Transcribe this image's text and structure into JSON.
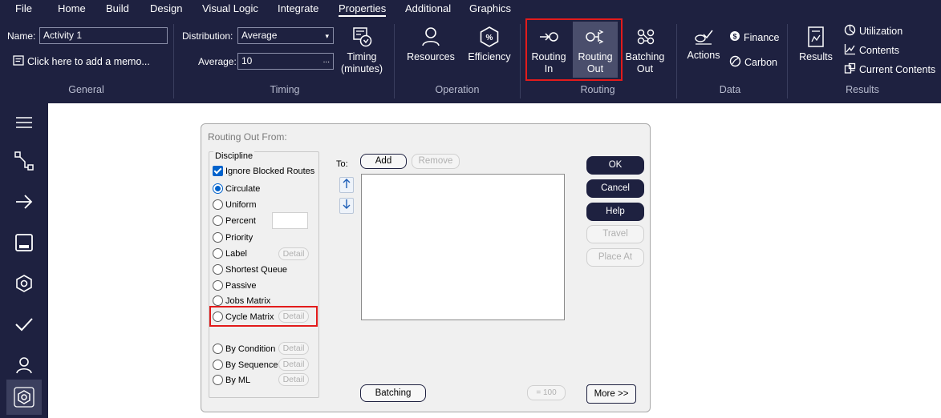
{
  "menu": {
    "tabs": [
      "File",
      "Home",
      "Build",
      "Design",
      "Visual Logic",
      "Integrate",
      "Properties",
      "Additional",
      "Graphics"
    ],
    "active": "Properties"
  },
  "general": {
    "name_label": "Name:",
    "name_value": "Activity 1",
    "memo": "Click here to add a memo...",
    "group": "General"
  },
  "timing": {
    "distribution_label": "Distribution:",
    "distribution_value": "Average",
    "average_label": "Average:",
    "average_value": "10",
    "ellipsis": "...",
    "timing_button": [
      "Timing",
      "(minutes)"
    ],
    "group": "Timing"
  },
  "operation": {
    "resources": "Resources",
    "efficiency": "Efficiency",
    "group": "Operation"
  },
  "routing": {
    "routing_in": [
      "Routing",
      "In"
    ],
    "routing_out": [
      "Routing",
      "Out"
    ],
    "batching_out": [
      "Batching",
      "Out"
    ],
    "group": "Routing"
  },
  "data_group": {
    "actions": "Actions",
    "finance": "Finance",
    "carbon": "Carbon",
    "group": "Data"
  },
  "results_group": {
    "results": "Results",
    "utilization": "Utilization",
    "contents": "Contents",
    "current_contents": "Current Contents",
    "group": "Results"
  },
  "sidebar": {
    "icons": [
      "menu-icon",
      "connector-icon",
      "arrow-right-icon",
      "save-icon",
      "settings-hexagon-icon",
      "check-icon",
      "user-icon",
      "active-settings-icon"
    ]
  },
  "dialog": {
    "title": "Routing Out From:",
    "discipline_legend": "Discipline",
    "ignore_blocked": "Ignore Blocked Routes",
    "options": {
      "circulate": "Circulate",
      "uniform": "Uniform",
      "percent": "Percent",
      "priority": "Priority",
      "label": "Label",
      "shortest_queue": "Shortest Queue",
      "passive": "Passive",
      "jobs_matrix": "Jobs Matrix",
      "cycle_matrix": "Cycle Matrix",
      "by_condition": "By Condition",
      "by_sequence": "By Sequence",
      "by_ml": "By ML"
    },
    "selected_option": "Circulate",
    "detail": "Detail",
    "to_label": "To:",
    "add": "Add",
    "remove": "Remove",
    "batching": "Batching",
    "eq_100": "= 100",
    "ok": "OK",
    "cancel": "Cancel",
    "help": "Help",
    "travel": "Travel",
    "place_at": "Place At",
    "more": "More >>"
  },
  "colors": {
    "ribbon_bg": "#1e2140",
    "highlight": "#e21b1b",
    "accent": "#0062cc"
  }
}
